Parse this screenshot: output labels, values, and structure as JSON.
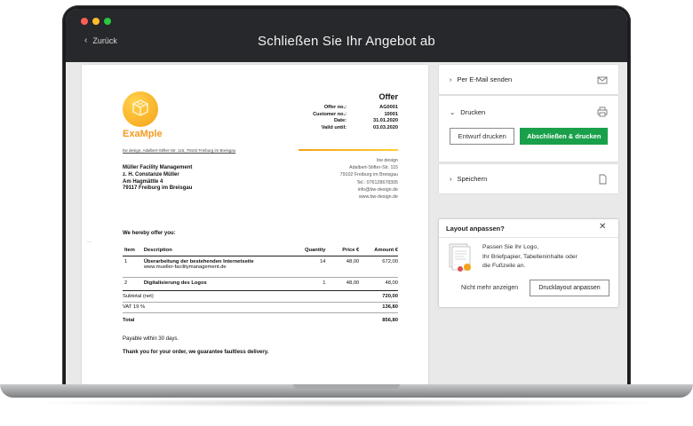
{
  "window": {
    "back_label": "Zurück",
    "title": "Schließen Sie Ihr Angebot ab",
    "dot_colors": [
      "#ff5f57",
      "#febc2e",
      "#28c840"
    ]
  },
  "document": {
    "brand": "ExaMple",
    "sender_line": "bw design, Adalbert-Stifter-Str. 115, 79102 Freiburg im Breisgau",
    "offer_title": "Offer",
    "meta": [
      {
        "label": "Offer no.:",
        "value": "AG0001"
      },
      {
        "label": "Customer no.:",
        "value": "10001"
      },
      {
        "label": "Date:",
        "value": "31.01.2020"
      },
      {
        "label": "Valid until:",
        "value": "03.03.2020"
      }
    ],
    "company": [
      "bw design",
      "Adalbert-Stifter-Str. 115",
      "79102 Freiburg im Breisgau",
      "Tel.: 076128678305",
      "info@bw-design.de",
      "www.bw-design.de"
    ],
    "recipient": [
      "Müller Facility Management",
      "z. H. Constanze Müller",
      "Am Hagmättle 4",
      "79117 Freiburg im Breisgau"
    ],
    "intro": "We hereby offer you:",
    "side_dots": "...",
    "table": {
      "headers": {
        "item": "Item",
        "description": "Description",
        "quantity": "Quantity",
        "price": "Price €",
        "amount": "Amount €"
      },
      "rows": [
        {
          "item": "1",
          "title": "Überarbeitung der bestehenden Internetseite",
          "subtitle": "www.mueller-facilitymanagement.de",
          "quantity": "14",
          "price": "48,00",
          "amount": "672,00"
        },
        {
          "item": "2",
          "title": "Digitalisierung des Logos",
          "subtitle": "",
          "quantity": "1",
          "price": "48,00",
          "amount": "48,00"
        }
      ],
      "subtotal_label": "Subtotal (net)",
      "subtotal_value": "720,00",
      "vat_label": "VAT 19 %",
      "vat_value": "136,80",
      "total_label": "Total",
      "total_value": "856,80"
    },
    "payable": "Payable within 30 days.",
    "thanks": "Thank you for your order, we guarantee faultless delivery."
  },
  "panel": {
    "email_label": "Per E-Mail senden",
    "print_label": "Drucken",
    "draft_button": "Entwurf drucken",
    "finish_button": "Abschließen & drucken",
    "save_label": "Speichern"
  },
  "tip": {
    "title": "Layout anpassen?",
    "text_lines": [
      "Passen Sie Ihr Logo,",
      "Ihr Briefpapier, Tabelleninhalte oder",
      "die Fußzeile an."
    ],
    "dismiss": "Nicht mehr anzeigen",
    "action": "Drucklayout anpassen"
  }
}
